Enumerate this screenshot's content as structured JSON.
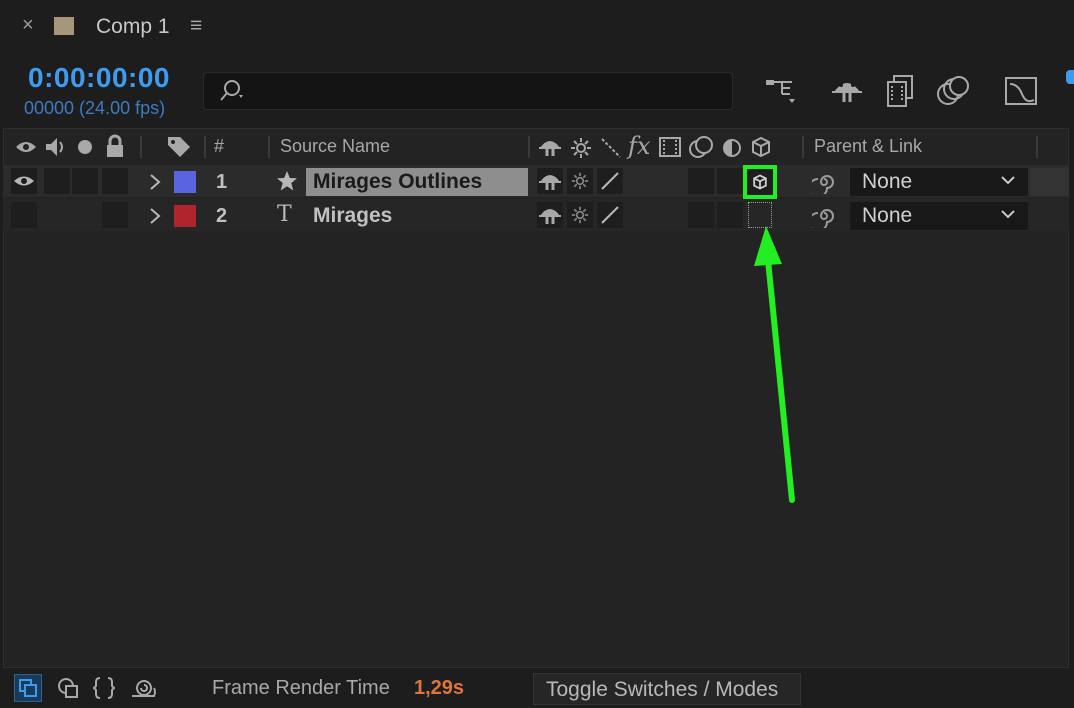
{
  "tab": {
    "close": "×",
    "title": "Comp 1",
    "menu": "≡"
  },
  "time": {
    "timecode": "0:00:00:00",
    "frames_fps": "00000 (24.00 fps)"
  },
  "search": {
    "placeholder": ""
  },
  "toolbar": {
    "icons": [
      "flowchart-icon",
      "draft-3d-icon",
      "frame-blending-icon",
      "motion-blur-icon",
      "graph-editor-icon"
    ]
  },
  "columns": {
    "number": "#",
    "source_name": "Source Name",
    "parent_link": "Parent & Link",
    "fx": "fx"
  },
  "layers": [
    {
      "number": "1",
      "name": "Mirages Outlines",
      "type_icon": "star-icon",
      "label_color": "#5a64e0",
      "parent": "None",
      "visible": true,
      "selected": true,
      "three_d": true
    },
    {
      "number": "2",
      "name": "Mirages",
      "type_icon": "text-layer-icon",
      "type_glyph": "T",
      "label_color": "#b0252d",
      "parent": "None",
      "visible": false,
      "selected": false,
      "three_d": false
    }
  ],
  "annotation": {
    "color": "#22ee22",
    "target": "3d-layer-switch"
  },
  "footer": {
    "frame_render_label": "Frame Render Time",
    "frame_render_value": "1,29s",
    "toggle_label": "Toggle Switches / Modes"
  }
}
